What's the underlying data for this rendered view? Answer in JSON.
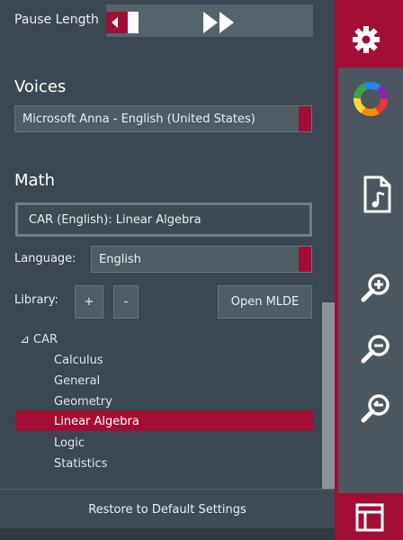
{
  "pause_length": {
    "label": "Pause Length"
  },
  "voices": {
    "title": "Voices",
    "selected": "Microsoft Anna - English (United States)"
  },
  "math": {
    "title": "Math",
    "ruleset": "CAR (English): Linear Algebra",
    "language_label": "Language:",
    "language_value": "English",
    "library_label": "Library:",
    "add_label": "+",
    "remove_label": "-",
    "open_mlde_label": "Open MLDE"
  },
  "tree": {
    "root": "⊿ CAR",
    "items": [
      "Calculus",
      "General",
      "Geometry",
      "Linear Algebra",
      "Logic",
      "Statistics"
    ],
    "selected_index": 3
  },
  "footer": {
    "restore_label": "Restore to Default Settings"
  },
  "colors": {
    "accent": "#a20e36",
    "panel": "#3b4851",
    "toolbar": "#4b565e"
  },
  "toolbar_icons": [
    "gear-icon",
    "color-wheel-icon",
    "document-audio-icon",
    "zoom-in-icon",
    "zoom-out-icon",
    "zoom-reset-icon",
    "layout-icon"
  ]
}
